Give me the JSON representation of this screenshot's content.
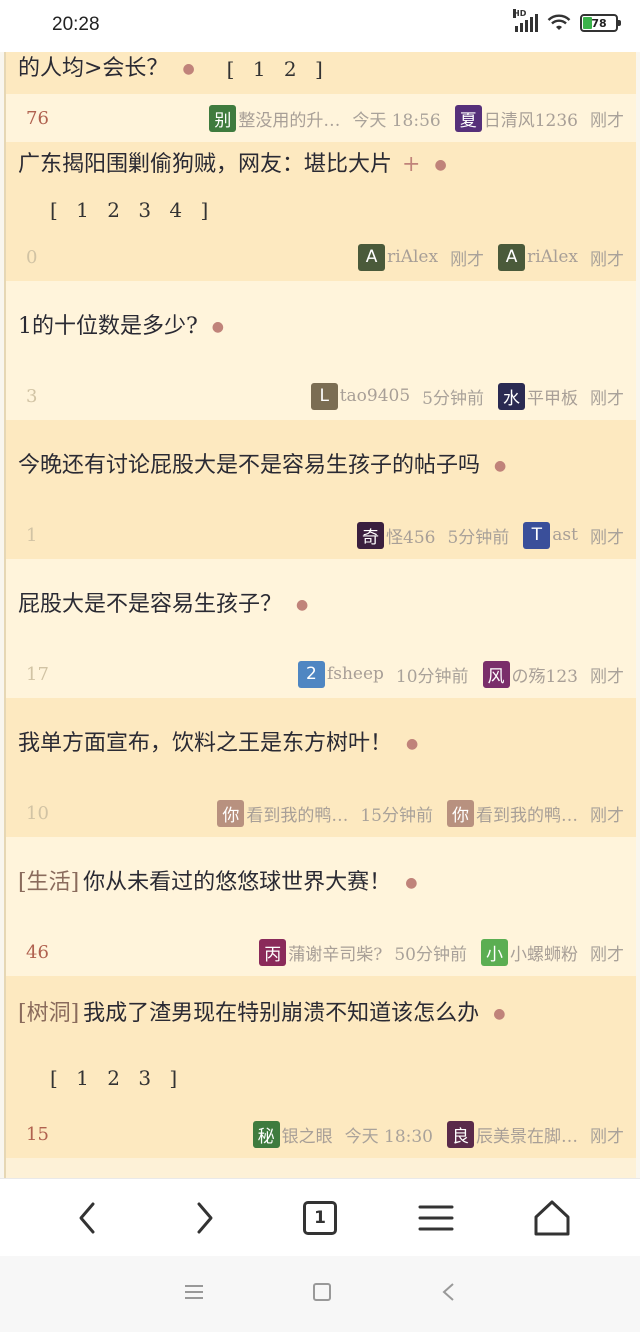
{
  "status_bar": {
    "time": "20:28",
    "network_label": "HD",
    "battery": "78"
  },
  "partial_top": {
    "title": "的人均>会长？",
    "pages": "[ 1 2 ]"
  },
  "threads": [
    {
      "count": "76",
      "author": "整没用的升…",
      "author_avatar": "别",
      "author_color": "#3f7b3e",
      "posted": "今天 18:56",
      "last_user": "日清风1236",
      "last_avatar": "夏",
      "last_color": "#56307a",
      "last_time": "刚才",
      "tag": "",
      "title": "广东揭阳围剿偷狗贼，网友：堪比大片",
      "has_plus": true,
      "pages": "[ 1 2 3 4 ]"
    },
    {
      "count": "0",
      "author": "riAlex",
      "author_avatar": "A",
      "author_color": "#4a5a3a",
      "posted": "刚才",
      "last_user": "riAlex",
      "last_avatar": "A",
      "last_color": "#4a5a3a",
      "last_time": "刚才",
      "tag": "",
      "title": "1的十位数是多少?",
      "has_plus": false,
      "pages": ""
    },
    {
      "count": "3",
      "author": "tao9405",
      "author_avatar": "L",
      "author_color": "#7b6d53",
      "posted": "5分钟前",
      "last_user": "平甲板",
      "last_avatar": "水",
      "last_color": "#2a2a52",
      "last_time": "刚才",
      "tag": "",
      "title": "今晚还有讨论屁股大是不是容易生孩子的帖子吗",
      "has_plus": false,
      "pages": ""
    },
    {
      "count": "1",
      "author": "怪456",
      "author_avatar": "奇",
      "author_color": "#3a1f3f",
      "posted": "5分钟前",
      "last_user": "ast",
      "last_avatar": "T",
      "last_color": "#3a4f9a",
      "last_time": "刚才",
      "tag": "",
      "title": "屁股大是不是容易生孩子？",
      "has_plus": false,
      "pages": ""
    },
    {
      "count": "17",
      "author": "fsheep",
      "author_avatar": "2",
      "author_color": "#4f86c2",
      "posted": "10分钟前",
      "last_user": "の殇123",
      "last_avatar": "风",
      "last_color": "#7a2e6a",
      "last_time": "刚才",
      "tag": "",
      "title": "我单方面宣布，饮料之王是东方树叶！",
      "has_plus": false,
      "pages": ""
    },
    {
      "count": "10",
      "author": "看到我的鸭…",
      "author_avatar": "你",
      "author_color": "#b8917f",
      "posted": "15分钟前",
      "last_user": "看到我的鸭…",
      "last_avatar": "你",
      "last_color": "#b8917f",
      "last_time": "刚才",
      "tag": "[生活]",
      "title": "你从未看过的悠悠球世界大赛！",
      "has_plus": false,
      "pages": ""
    },
    {
      "count": "46",
      "author": "蒲谢辛司柴?",
      "author_avatar": "丙",
      "author_color": "#8a2a5a",
      "posted": "50分钟前",
      "last_user": "小螺蛳粉",
      "last_avatar": "小",
      "last_color": "#5bae52",
      "last_time": "刚才",
      "tag": "[树洞]",
      "title": "我成了渣男现在特别崩溃不知道该怎么办",
      "has_plus": false,
      "pages": "[ 1 2 3 ]"
    },
    {
      "count": "15",
      "author": "银之眼",
      "author_avatar": "秘",
      "author_color": "#3f7b3e",
      "posted": "今天 18:30",
      "last_user": "辰美景在脚…",
      "last_avatar": "良",
      "last_color": "#5a2a4a",
      "last_time": "刚才",
      "tag": "",
      "title": "",
      "has_plus": false,
      "pages": ""
    }
  ],
  "bottom_nav": {
    "back_icon": "chevron-left-icon",
    "forward_icon": "chevron-right-icon",
    "tabs_count": "1",
    "menu_icon": "hamburger-icon",
    "home_icon": "home-icon"
  },
  "system_nav": {
    "recents": "menu-icon",
    "home": "square-icon",
    "back": "triangle-back-icon"
  }
}
